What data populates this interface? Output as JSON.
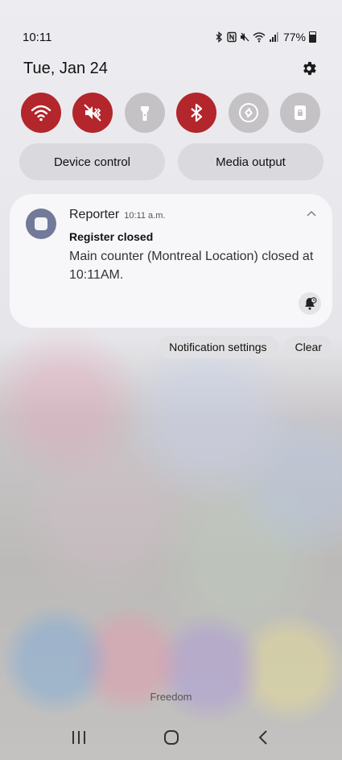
{
  "status_bar": {
    "time": "10:11",
    "battery_percent": "77%",
    "battery_level": 0.77,
    "icons": [
      "bluetooth-icon",
      "nfc-icon",
      "mute-icon",
      "wifi-icon",
      "signal-icon",
      "battery-icon"
    ]
  },
  "quick_panel": {
    "date": "Tue, Jan 24",
    "settings_icon": "gear-icon",
    "tiles": [
      {
        "icon": "wifi-icon",
        "state": "on"
      },
      {
        "icon": "mute-icon",
        "state": "on"
      },
      {
        "icon": "flashlight-icon",
        "state": "off"
      },
      {
        "icon": "bluetooth-icon",
        "state": "on"
      },
      {
        "icon": "shazam-icon",
        "state": "off"
      },
      {
        "icon": "lock-icon",
        "state": "off"
      }
    ],
    "device_control_label": "Device control",
    "media_output_label": "Media output"
  },
  "notification": {
    "app_name": "Reporter",
    "time": "10:11 a.m.",
    "title": "Register closed",
    "body": "Main counter (Montreal Location) closed at 10:11AM."
  },
  "actions": {
    "settings_label": "Notification settings",
    "clear_label": "Clear"
  },
  "carrier": "Freedom",
  "colors": {
    "tile_on": "#b3262c",
    "tile_off": "#c4c2c4",
    "app_icon": "#727a9a"
  }
}
